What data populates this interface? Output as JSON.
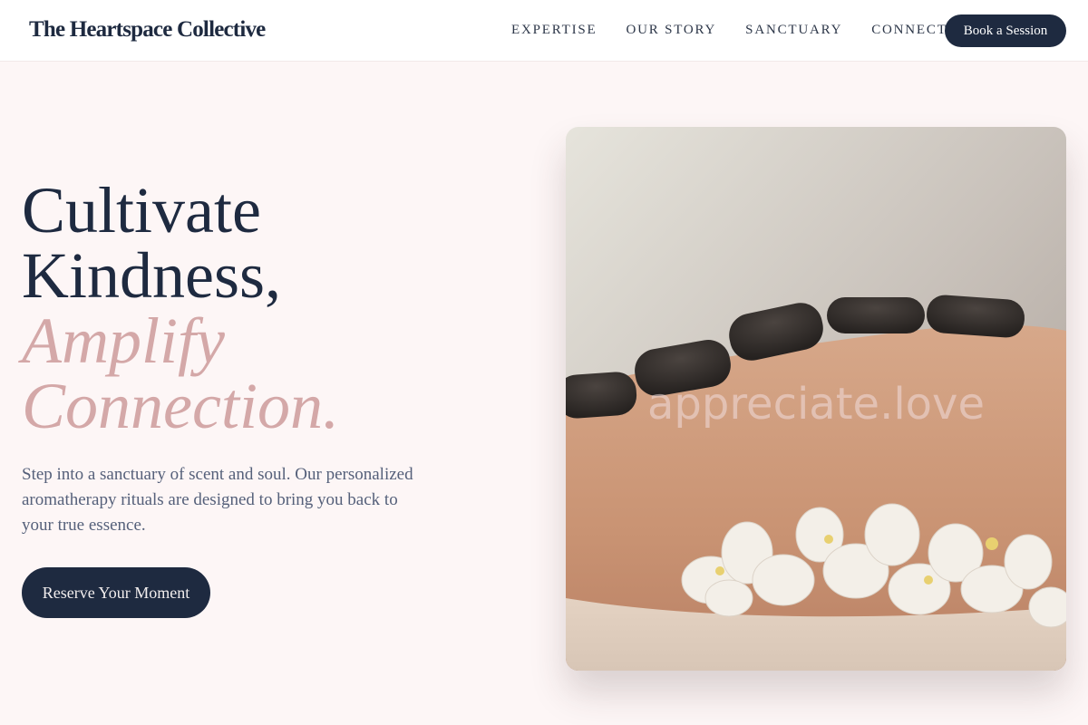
{
  "brand": {
    "name": "The Heartspace Collective"
  },
  "nav": {
    "items": [
      {
        "label": "EXPERTISE"
      },
      {
        "label": "OUR STORY"
      },
      {
        "label": "SANCTUARY"
      },
      {
        "label": "CONNECT"
      }
    ],
    "cta_label": "Book a Session"
  },
  "hero": {
    "title_line1": "Cultivate",
    "title_line2": "Kindness,",
    "title_line3": "Amplify",
    "title_line4": "Connection.",
    "description": "Step into a sanctuary of scent and soul. Our personalized aromatherapy rituals are designed to bring you back to your true essence.",
    "cta_label": "Reserve Your Moment",
    "image_watermark": "appreciate.love"
  },
  "colors": {
    "navy": "#1e2a40",
    "rose_accent": "#d4a8a8",
    "background": "#fdf6f6"
  }
}
